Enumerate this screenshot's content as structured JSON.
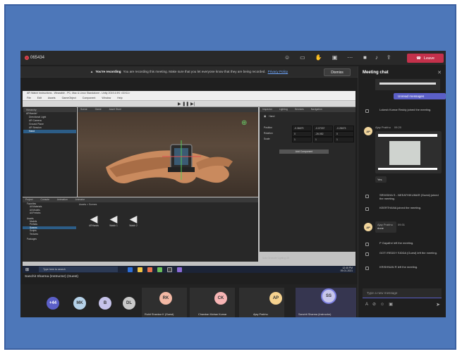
{
  "meeting": {
    "timer": "065434",
    "leave_label": "Leave",
    "recording_banner": {
      "bold": "You're recording",
      "text": "You are recording this meeting. Make sure that you let everyone know that they are being recorded.",
      "link": "Privacy Policy"
    },
    "dismiss_label": "Dismiss",
    "presenter_label": "Sanchit Sharma (Instructor) (Guest)"
  },
  "unity": {
    "window_title": "AR Watch Instructions - Wearable - PC, Mac & Linux Standalone - Unity 2019.4.9f1 <DX11>",
    "menu": [
      "File",
      "Edit",
      "Assets",
      "GameObject",
      "Component",
      "Window",
      "Help"
    ],
    "scene_tabs": [
      "Scene",
      "Game",
      "Asset Store"
    ],
    "hierarchy_tab": "Hierarchy",
    "hierarchy_items": [
      "ARHands*",
      "Directional Light",
      "AR Camera",
      "Ground Plane",
      "AR Session",
      "Hand"
    ],
    "inspector_tabs": [
      "Inspector",
      "Lighting",
      "Services",
      "Navigation"
    ],
    "inspector_object": "Hand",
    "inspector_rows": [
      {
        "label": "Position",
        "x": "-0.36679",
        "y": "-0.07037",
        "z": "-0.28473"
      },
      {
        "label": "Rotation",
        "x": "0",
        "y": "-26.052",
        "z": "0"
      },
      {
        "label": "Scale",
        "x": "1",
        "y": "1",
        "z": "1"
      }
    ],
    "add_component": "Add Component",
    "project_tabs": [
      "Project",
      "Console",
      "Animation",
      "Animator"
    ],
    "project_folders": [
      "Favorites",
      "All Materials",
      "All Models",
      "All Prefabs",
      "Assets",
      "Models",
      "Prefabs",
      "Scenes",
      "Scripts",
      "Textures",
      "Packages"
    ],
    "breadcrumb": "Assets > Scenes",
    "assets": [
      "ARHands",
      "Watch 1",
      "Watch 2"
    ],
    "status": "Auto Generate Lighting Off"
  },
  "taskbar": {
    "search_placeholder": "Type here to search",
    "clock": "12:45 PM",
    "date": "09-01-2021",
    "colors": [
      "#2d6fd6",
      "#f4c541",
      "#e8734a",
      "#6bbf59",
      "#444444",
      "#8c6bd6"
    ]
  },
  "participants": {
    "circles": [
      {
        "initials": "+44",
        "color": "#5b5fc7"
      },
      {
        "initials": "MK",
        "color": "#b5d1e8"
      },
      {
        "initials": "B",
        "color": "#c6c3ea"
      },
      {
        "initials": "DL",
        "color": "#c8c8c8"
      }
    ],
    "tiles": [
      {
        "initials": "RK",
        "name": "Rohit Shankar K (Guest)",
        "color": "#f3b8a4"
      },
      {
        "initials": "CK",
        "name": "Chandan Mohan Kumar",
        "color": "#f7b5b5"
      },
      {
        "initials": "AP",
        "name": "Ajay Prabhu",
        "color": "#f6d28f"
      },
      {
        "initials": "SS",
        "name": "Sanchit Sharma (Instructor)",
        "color": "#c7c6ec"
      }
    ]
  },
  "chat": {
    "title": "Meeting chat",
    "unread": "Unread messages",
    "events": [
      "Lokesh Kumar Reddy joined the meeting.",
      "SRIVIDHA S - NEEATHIKUMAR (Guest) joined the meeting.",
      "KEERTHANA joined the meeting.",
      "P Gayathri left the meeting.",
      "GOTI REDDY SIDDA (Guest) left the meeting.",
      "KRISHNAN R left the meeting."
    ],
    "messages": [
      {
        "author": "Ajay Prabhu",
        "time": "09:20",
        "text": ""
      },
      {
        "author": "Ajay Prabhu",
        "time": "09:31",
        "text": "done"
      }
    ],
    "short_reply": "Yes",
    "compose_placeholder": "Type a new message"
  }
}
